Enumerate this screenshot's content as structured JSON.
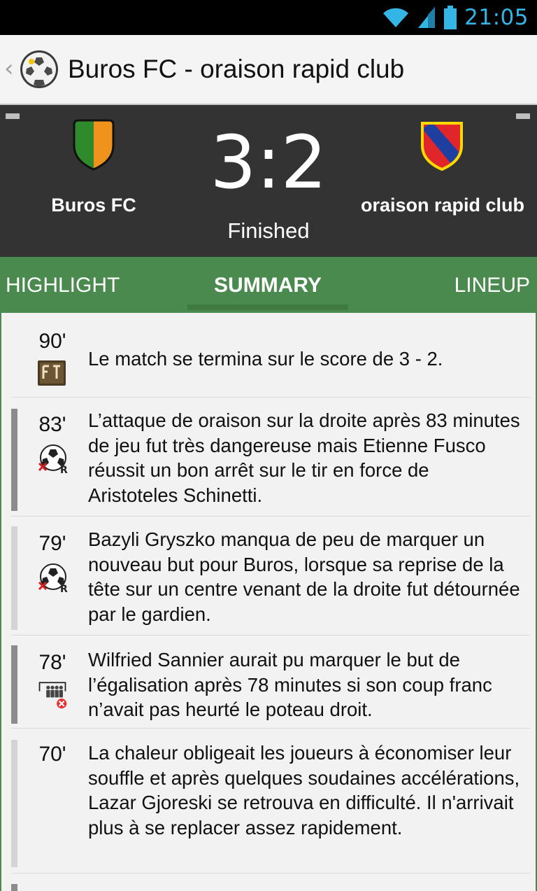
{
  "status_bar": {
    "time": "21:05",
    "icons": [
      "wifi-icon",
      "cell-signal-icon",
      "battery-icon"
    ]
  },
  "action_bar": {
    "title": "Buros FC - oraison rapid club",
    "icon": "soccer-ball-logo"
  },
  "match": {
    "home_team": "Buros FC",
    "away_team": "oraison rapid club",
    "score": "3:2",
    "status": "Finished",
    "home_crest_colors": [
      "#2f8a2b",
      "#f0931d"
    ],
    "away_crest_colors": [
      "#e0262a",
      "#1f3fa0",
      "#ffd800"
    ]
  },
  "tabs": [
    {
      "label": "HIGHLIGHT",
      "selected": false
    },
    {
      "label": "SUMMARY",
      "selected": true
    },
    {
      "label": "LINEUP",
      "selected": false
    }
  ],
  "events": [
    {
      "minute": "90'",
      "icon": "full-time-icon",
      "text": "Le match se termina sur le score de 3 - 2.",
      "side": "none"
    },
    {
      "minute": "83'",
      "icon": "missed-shot-icon",
      "text": "L’attaque de oraison sur la droite après 83 minutes de jeu fut très dangereuse mais Etienne Fusco réussit un bon arrêt sur le tir en force de Aristoteles Schinetti.",
      "side": "home"
    },
    {
      "minute": "79'",
      "icon": "missed-shot-icon",
      "text": "Bazyli Gryszko manqua de peu de marquer un nouveau but pour Buros, lorsque sa reprise de la tête sur un centre venant de la droite fut détournée par le gardien.",
      "side": "away"
    },
    {
      "minute": "78'",
      "icon": "free-kick-wall-icon",
      "text": "Wilfried Sannier aurait pu marquer le but de l’égalisation après 78 minutes si son coup franc n’avait pas heurté le poteau droit.",
      "side": "home"
    },
    {
      "minute": "70'",
      "icon": "none",
      "text": "La chaleur obligeait les joueurs à économiser leur souffle et après quelques soudaines accélérations, Lazar Gjoreski se retrouva en difficulté. Il n'arrivait plus à se replacer assez rapidement.",
      "side": "away"
    }
  ],
  "colors": {
    "tab_bg": "#4a8a4e",
    "score_panel_bg": "#333333",
    "clock": "#33b5e5",
    "home_bar": "#8c8c8c",
    "away_bar": "#d4d4d4"
  }
}
